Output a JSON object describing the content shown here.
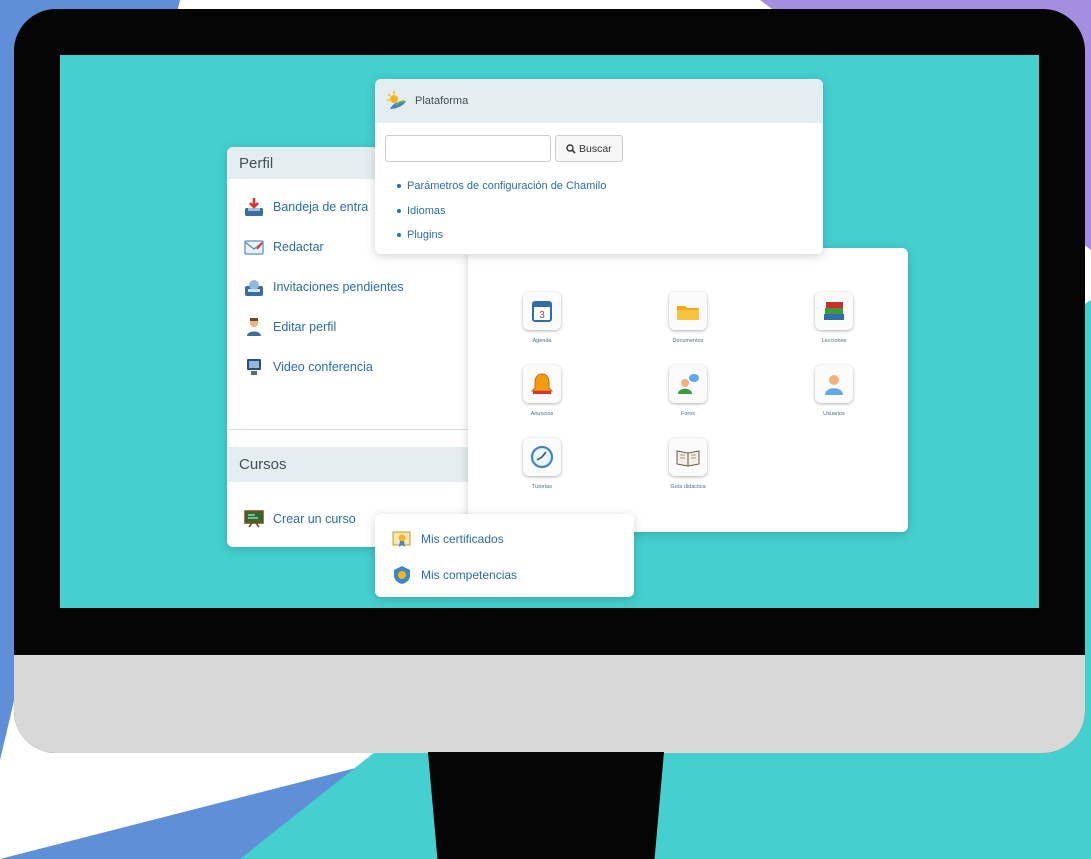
{
  "perfil": {
    "title": "Perfil",
    "items": [
      {
        "label": "Bandeja de entra",
        "icon": "inbox-download-icon"
      },
      {
        "label": "Redactar",
        "icon": "compose-envelope-icon"
      },
      {
        "label": "Invitaciones pendientes",
        "icon": "pending-invitations-icon"
      },
      {
        "label": "Editar perfil",
        "icon": "user-edit-icon"
      },
      {
        "label": "Video conferencia",
        "icon": "video-conference-icon"
      }
    ],
    "cursos_title": "Cursos",
    "crear_curso": {
      "label": "Crear un curso",
      "icon": "blackboard-icon"
    }
  },
  "plataforma": {
    "title": "Plataforma",
    "search": {
      "value": "",
      "button_label": "Buscar",
      "icon": "magnifier-icon"
    },
    "links": [
      "Parámetros de configuración de Chamilo",
      "Idiomas",
      "Plugins"
    ]
  },
  "tools": [
    {
      "label": "Agenda",
      "icon": "calendar-icon"
    },
    {
      "label": "Documentos",
      "icon": "folder-icon"
    },
    {
      "label": "Lecciones",
      "icon": "books-icon"
    },
    {
      "label": "Anuncios",
      "icon": "bell-icon"
    },
    {
      "label": "Foros",
      "icon": "forum-users-icon"
    },
    {
      "label": "Usuarios",
      "icon": "user-icon"
    },
    {
      "label": "Tutorías",
      "icon": "clock-icon"
    },
    {
      "label": "Guía didáctica",
      "icon": "open-book-icon"
    }
  ],
  "certificados": {
    "items": [
      {
        "label": "Mis certificados",
        "icon": "certificate-icon"
      },
      {
        "label": "Mis competencias",
        "icon": "badge-icon"
      }
    ]
  },
  "colors": {
    "screen": "#45cfcf",
    "link": "#2a6da8",
    "panel_header": "#e4eef1",
    "monitor": "#050505"
  }
}
